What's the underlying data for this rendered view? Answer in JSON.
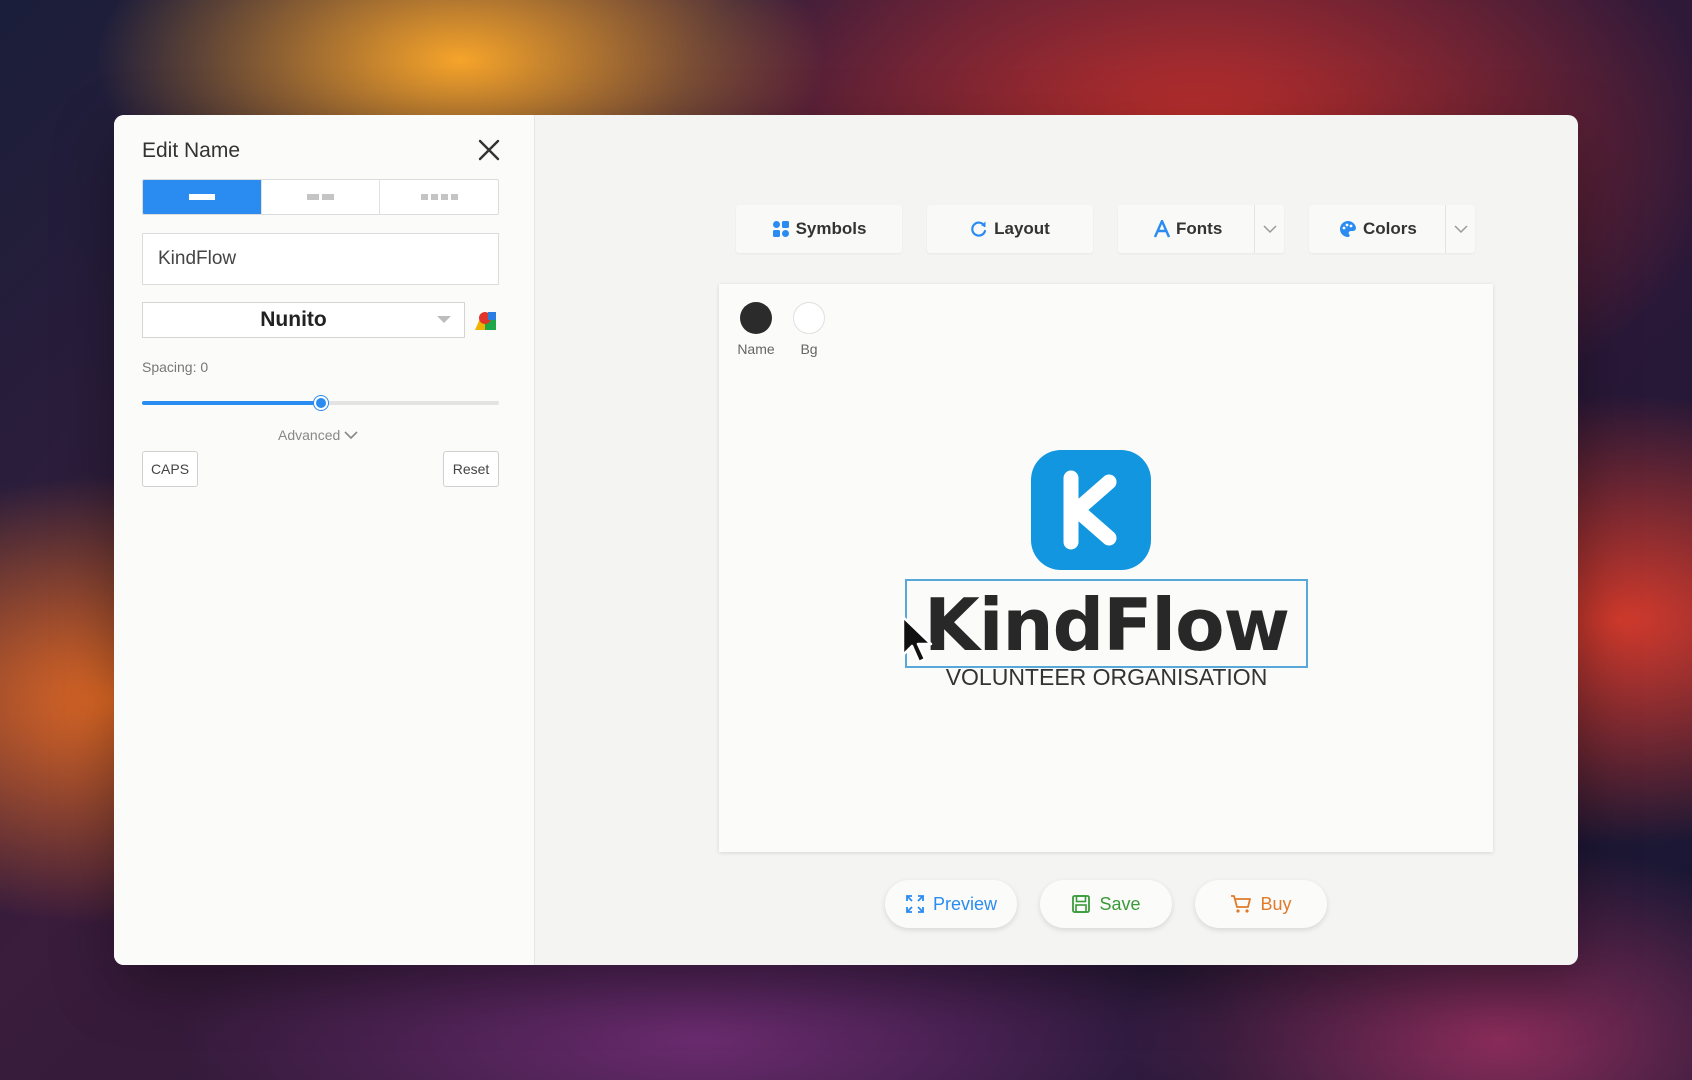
{
  "editor": {
    "title": "Edit Name",
    "name_value": "KindFlow",
    "font_value": "Nunito",
    "spacing_label": "Spacing:",
    "spacing_value": "0",
    "spacing_fraction": 0.5,
    "advanced_label": "Advanced",
    "caps_label": "CAPS",
    "reset_label": "Reset"
  },
  "toolbar": {
    "symbols_label": "Symbols",
    "layout_label": "Layout",
    "fonts_label": "Fonts",
    "colors_label": "Colors"
  },
  "canvas": {
    "swatches": [
      {
        "label": "Name",
        "color": "#2b2b2b"
      },
      {
        "label": "Bg",
        "color": "#ffffff"
      }
    ],
    "logo": {
      "symbol_letter": "K",
      "symbol_color": "#1296e0",
      "name": "KindFlow",
      "slogan": "VOLUNTEER ORGANISATION"
    }
  },
  "actions": {
    "preview_label": "Preview",
    "save_label": "Save",
    "buy_label": "Buy"
  },
  "colors": {
    "accent": "#2a8cf0",
    "preview": "#2a8cf0",
    "save": "#3a9a3a",
    "buy": "#e07b2a"
  }
}
